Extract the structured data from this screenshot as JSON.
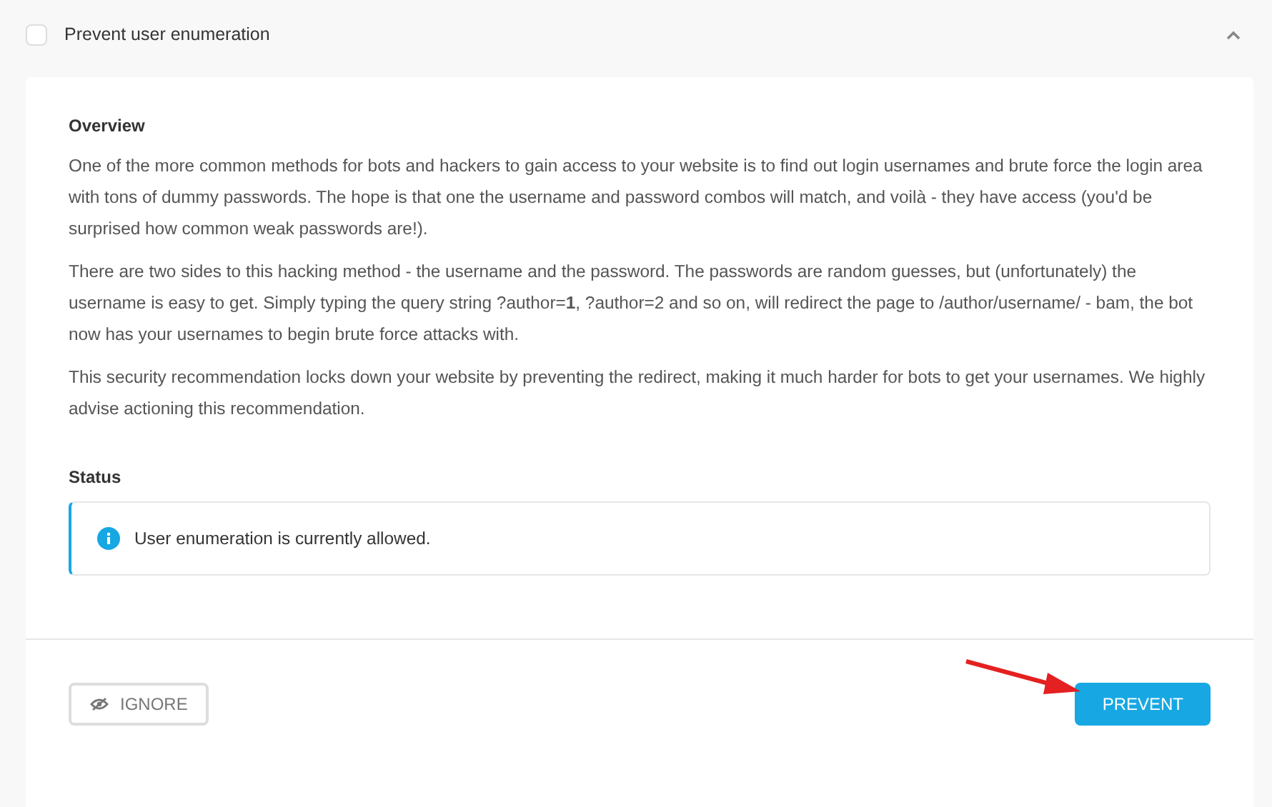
{
  "header": {
    "title": "Prevent user enumeration",
    "checked": false,
    "expanded": true
  },
  "overview": {
    "heading": "Overview",
    "paragraphs": [
      "One of the more common methods for bots and hackers to gain access to your website is to find out login usernames and brute force the login area with tons of dummy passwords. The hope is that one the username and password combos will match, and voilà - they have access (you'd be surprised how common weak passwords are!).",
      "There are two sides to this hacking method - the username and the password. The passwords are random guesses, but (unfortunately) the username is easy to get. Simply typing the query string ?author=**1**, ?author=2 and so on, will redirect the page to /author/username/ - bam, the bot now has your usernames to begin brute force attacks with.",
      "This security recommendation locks down your website by preventing the redirect, making it much harder for bots to get your usernames. We highly advise actioning this recommendation."
    ]
  },
  "status": {
    "heading": "Status",
    "notice": {
      "kind": "info",
      "text": "User enumeration is currently allowed."
    }
  },
  "buttons": [
    {
      "kind": "ghost",
      "label": "IGNORE"
    },
    {
      "kind": "primary",
      "label": "PREVENT"
    }
  ]
}
